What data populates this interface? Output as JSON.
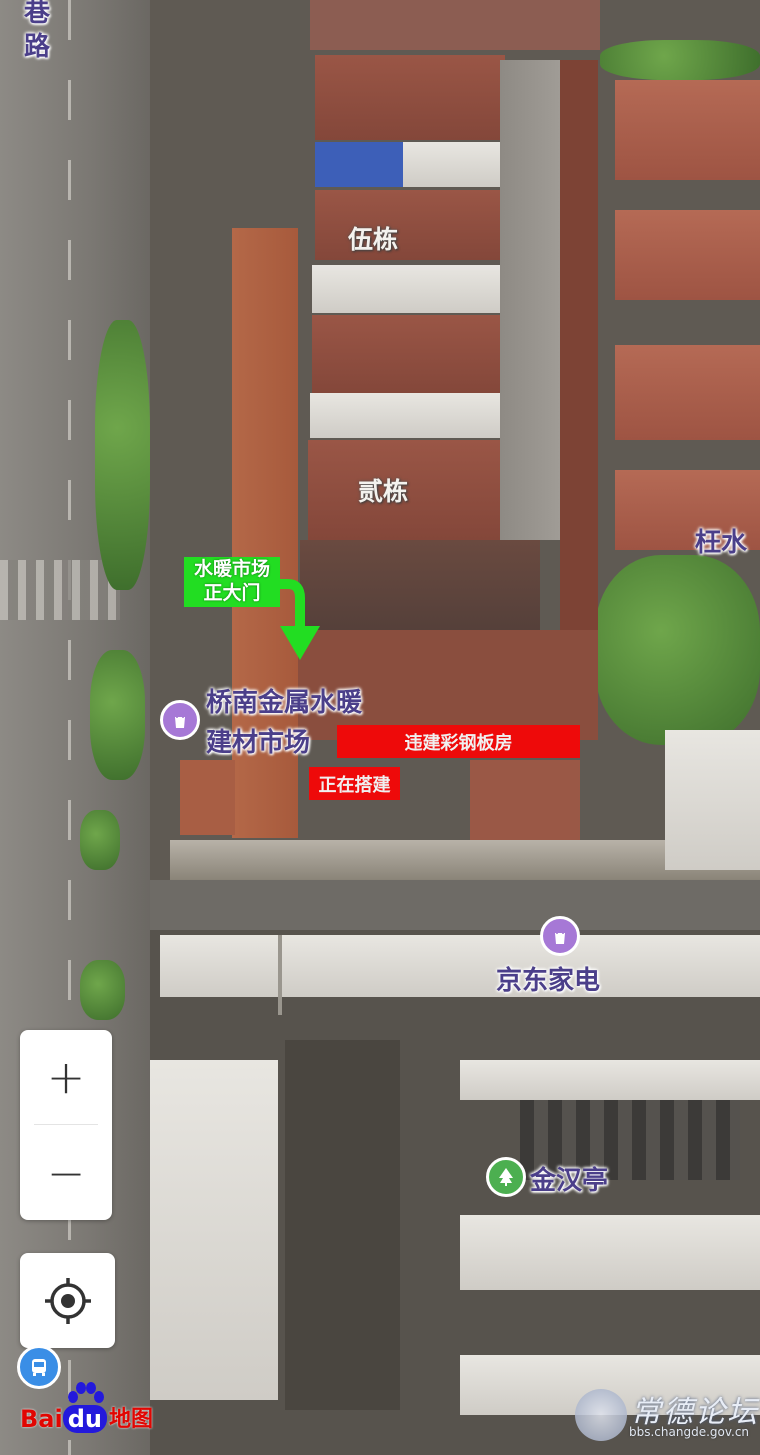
{
  "labels": {
    "road_partial": "巷路",
    "building_5": "伍栋",
    "building_2": "贰栋",
    "neighbor_partial": "枉水",
    "market_line1": "桥南金属水暖",
    "market_line2": "建材市场",
    "jd": "京东家电",
    "jinhanting": "金汉亭"
  },
  "annotations": {
    "gate_line1": "水暖市场",
    "gate_line2": "正大门",
    "illegal": "违建彩钢板房",
    "building_now": "正在搭建"
  },
  "controls": {
    "zoom_in": "+",
    "zoom_out": "−"
  },
  "logo": {
    "baidu_text": "Bai",
    "du_text": "du",
    "map_text": "地图"
  },
  "watermark": {
    "title": "常德论坛",
    "url": "bbs.changde.gov.cn"
  },
  "colors": {
    "annotation_red": "#ee0a0a",
    "annotation_green": "#22dd22",
    "label_purple": "#4b3f8a",
    "poi_purple": "#a678d6",
    "poi_green": "#4caf50"
  },
  "icons": [
    "bag-icon",
    "tree-icon",
    "locate-icon",
    "bus-icon",
    "down-arrow-icon",
    "paw-icon"
  ]
}
